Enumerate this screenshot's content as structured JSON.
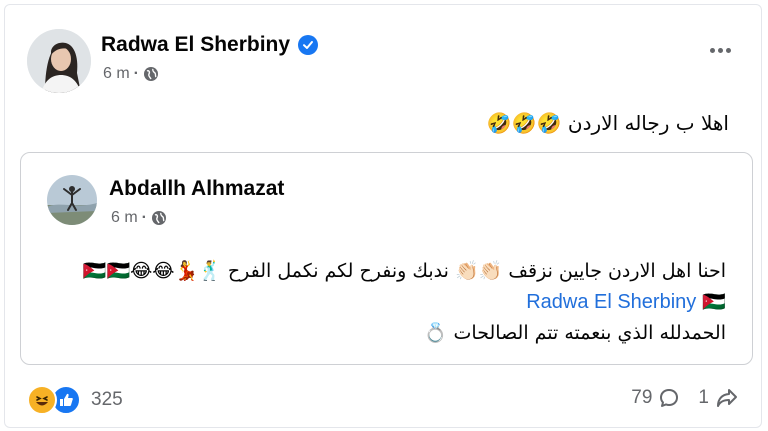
{
  "post": {
    "author_name": "Radwa El Sherbiny",
    "timestamp": "6 m",
    "dot": "·",
    "text": "اهلا ب رجاله الاردن",
    "text_emojis": "🤣🤣🤣",
    "avatar_icon": "profile-photo",
    "verified_icon": "verified-badge",
    "audience_icon": "globe-icon",
    "more_icon": "more-options-icon"
  },
  "shared_post": {
    "author_name": "Abdallh Alhmazat",
    "timestamp": "6 m",
    "dot": "·",
    "line1_text": "احنا اهل الاردن جايين نزقف",
    "line1_emoji_a": "👏🏻👏🏻",
    "line1_text_b": "ندبك ونفرح لكم نكمل الفرح",
    "line1_emoji_b": "🕺💃😂😂🇯🇴🇯🇴",
    "line2_flag": "🇯🇴",
    "line2_mention": "Radwa El Sherbiny",
    "line3_text": "الحمدلله الذي بنعمته تتم الصالحات",
    "line3_emoji": "💍"
  },
  "footer": {
    "reaction_count": "325",
    "comments_count": "79",
    "shares_count": "1",
    "colors": {
      "haha": "#f7b125",
      "like": "#1877f2",
      "mention": "#216fdb",
      "secondary": "#65676b"
    }
  }
}
